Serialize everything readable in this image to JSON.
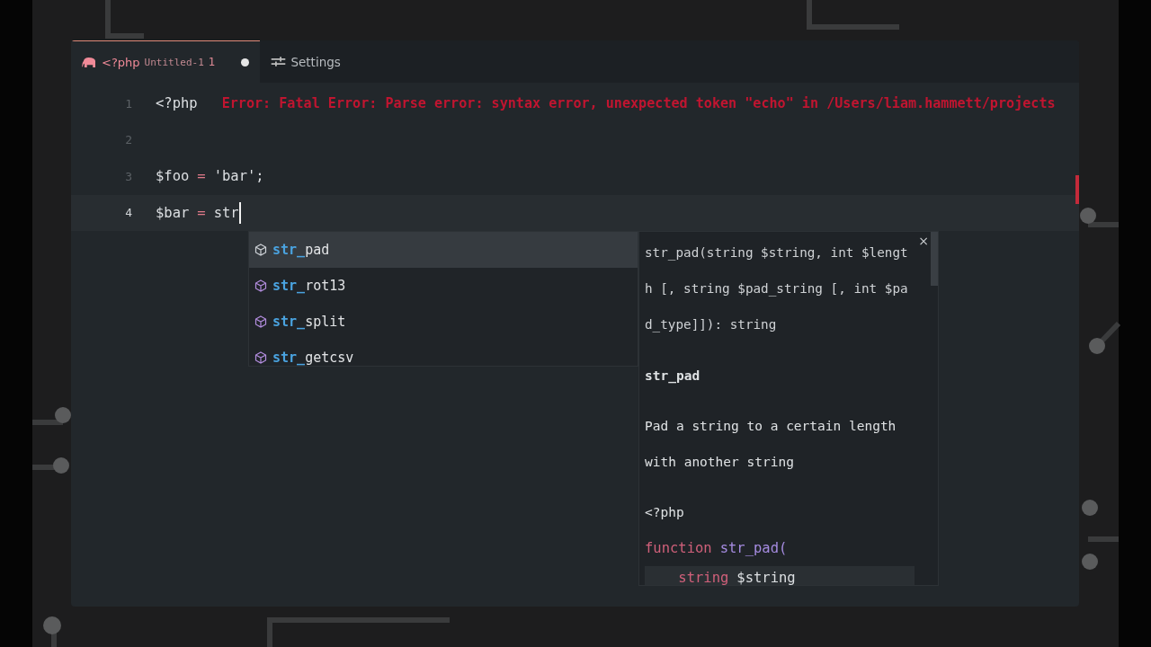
{
  "tabs": [
    {
      "kind": "php",
      "label": "<?php",
      "detail": "Untitled-1",
      "problems": "1",
      "dirty": true,
      "selected": true
    },
    {
      "kind": "settings",
      "label": "Settings",
      "dirty": false,
      "selected": false
    }
  ],
  "editor": {
    "lines": [
      {
        "number": "1",
        "current": false,
        "tokens": [
          {
            "kind": "plain",
            "text": "<?php"
          }
        ],
        "error": "Error: Fatal Error: Parse error: syntax error, unexpected token \"echo\" in /Users/liam.hammett/projects"
      },
      {
        "number": "2",
        "current": false
      },
      {
        "number": "3",
        "current": false,
        "tokens": [
          {
            "kind": "plain",
            "text": "$foo"
          },
          {
            "kind": "op",
            "text": "="
          },
          {
            "kind": "plain",
            "text": "'bar';"
          }
        ]
      },
      {
        "number": "4",
        "current": true,
        "tokens": [
          {
            "kind": "plain",
            "text": "$bar"
          },
          {
            "kind": "op",
            "text": "="
          },
          {
            "kind": "plain",
            "text": "str"
          }
        ]
      }
    ]
  },
  "suggestions": [
    {
      "match": "str_",
      "rest": "pad",
      "selected": true
    },
    {
      "match": "str_",
      "rest": "rot13",
      "selected": false
    },
    {
      "match": "str_",
      "rest": "split",
      "selected": false
    },
    {
      "match": "str_",
      "rest": "getcsv",
      "selected": false
    }
  ],
  "details": {
    "close": "×",
    "signature": [
      "str_pad(string $string, int $lengt",
      "h [, string $pad_string [, int $pa",
      "d_type]]): string"
    ],
    "name": "str_pad",
    "description": [
      "Pad a string to a certain length",
      "with another string"
    ],
    "example": [
      {
        "kind": "plain",
        "tokens": [
          {
            "kind": "plain",
            "text": "<?php"
          }
        ]
      },
      {
        "kind": "code",
        "tokens": [
          {
            "kind": "keyword",
            "text": "function"
          },
          {
            "kind": "func",
            "text": "str_pad("
          }
        ]
      },
      {
        "kind": "code",
        "tokens": [
          {
            "kind": "keyword",
            "text": "    string"
          },
          {
            "kind": "plain",
            "text": "$string"
          }
        ]
      }
    ]
  }
}
